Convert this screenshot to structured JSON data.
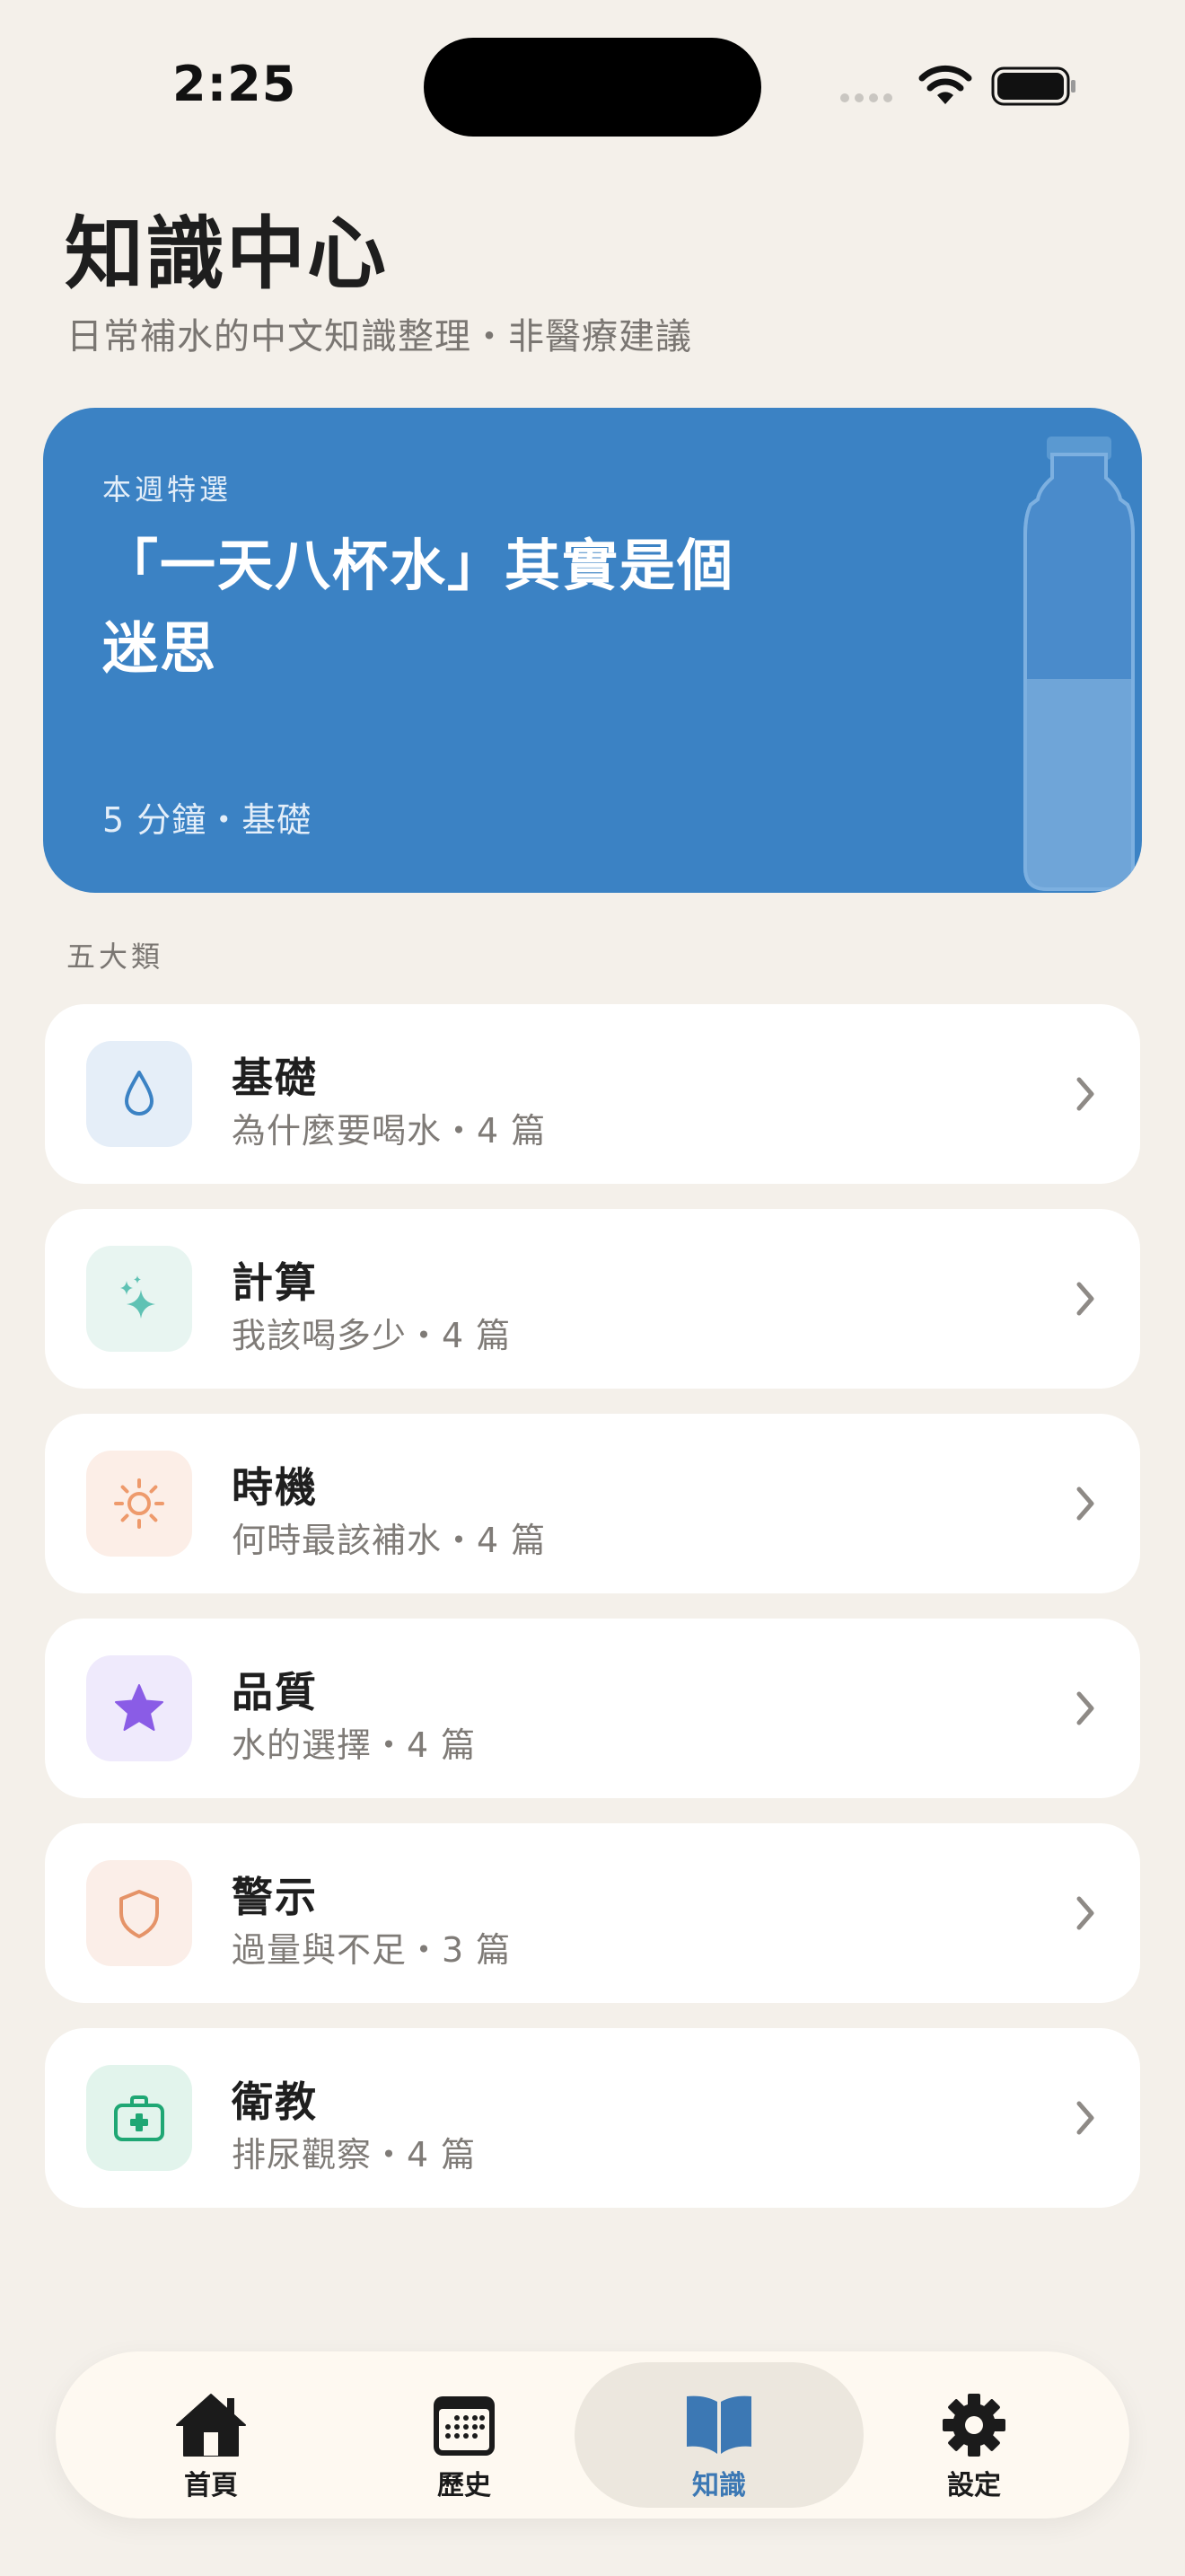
{
  "status_bar": {
    "time": "2:25"
  },
  "header": {
    "title": "知識中心",
    "subtitle": "日常補水的中文知識整理・非醫療建議"
  },
  "featured": {
    "eyebrow": "本週特選",
    "title": "「一天八杯水」其實是個迷思",
    "meta": "5 分鐘・基礎"
  },
  "section_label": "五大類",
  "categories": [
    {
      "title": "基礎",
      "subtitle": "為什麼要喝水・4 篇",
      "icon": "water-drop-icon",
      "icon_color": "#3B82C4",
      "icon_bg": "#E5EEF8"
    },
    {
      "title": "計算",
      "subtitle": "我該喝多少・4 篇",
      "icon": "sparkles-icon",
      "icon_color": "#5FC2B4",
      "icon_bg": "#E8F5F1"
    },
    {
      "title": "時機",
      "subtitle": "何時最該補水・4 篇",
      "icon": "sun-icon",
      "icon_color": "#EE9A6C",
      "icon_bg": "#FCEEE7"
    },
    {
      "title": "品質",
      "subtitle": "水的選擇・4 篇",
      "icon": "star-icon",
      "icon_color": "#8A5CE6",
      "icon_bg": "#EFEAFC"
    },
    {
      "title": "警示",
      "subtitle": "過量與不足・3 篇",
      "icon": "shield-icon",
      "icon_color": "#E59368",
      "icon_bg": "#FBEEE8"
    },
    {
      "title": "衛教",
      "subtitle": "排尿觀察・4 篇",
      "icon": "first-aid-kit-icon",
      "icon_color": "#1FA774",
      "icon_bg": "#E2F4EC"
    }
  ],
  "tabbar": {
    "items": [
      {
        "label": "首頁",
        "icon": "home-icon",
        "active": false
      },
      {
        "label": "歷史",
        "icon": "calendar-icon",
        "active": false
      },
      {
        "label": "知識",
        "icon": "book-icon",
        "active": true
      },
      {
        "label": "設定",
        "icon": "gear-icon",
        "active": false
      }
    ]
  },
  "colors": {
    "background": "#F4F0EA",
    "featured_card": "#3B82C4",
    "active_tab_label": "#3C78B4"
  }
}
